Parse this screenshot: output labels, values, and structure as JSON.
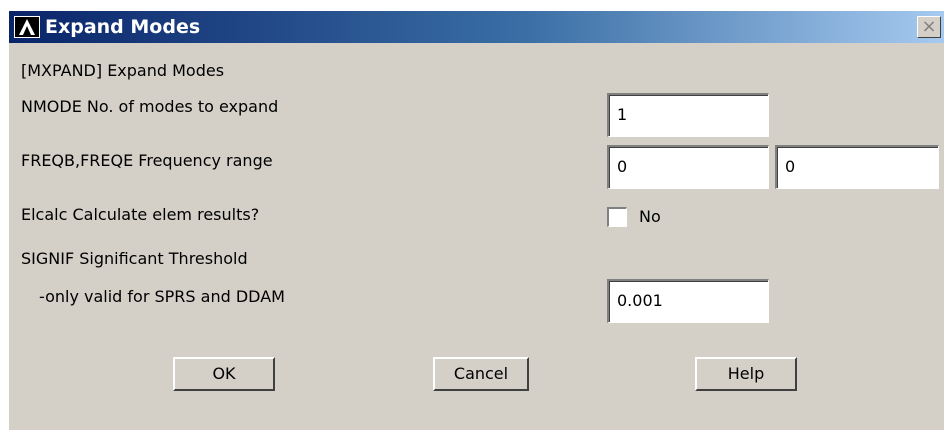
{
  "window": {
    "title": "Expand Modes",
    "close_glyph": "×",
    "logo_icon": "ansys-logo-icon",
    "title_color": "#0a246a"
  },
  "header": {
    "command": "[MXPAND]  Expand Modes"
  },
  "fields": {
    "nmode": {
      "label": "NMODE   No. of modes to expand",
      "value": "1"
    },
    "freq": {
      "label": "FREQB,FREQE   Frequency range",
      "freqb_value": "0",
      "freqe_value": "0"
    },
    "elcalc": {
      "label": "Elcalc  Calculate elem results?",
      "checked": false,
      "state_label": "No"
    },
    "signif": {
      "label": "SIGNIF Significant Threshold",
      "sublabel": "-only valid for SPRS and DDAM",
      "value": "0.001"
    }
  },
  "buttons": {
    "ok": "OK",
    "cancel": "Cancel",
    "help": "Help"
  }
}
